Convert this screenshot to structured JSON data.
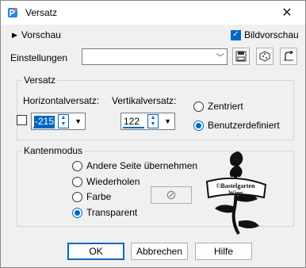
{
  "window": {
    "title": "Versatz",
    "close_glyph": "✕"
  },
  "toolbar": {
    "preview_label": "Vorschau",
    "bildvorschau_label": "Bildvorschau",
    "bildvorschau_checked": true,
    "settings_label": "Einstellungen",
    "settings_value": ""
  },
  "offset": {
    "group_title": "Versatz",
    "horizontal_label": "Horizontalversatz:",
    "horizontal_value": "-215",
    "vertical_label": "Vertikalversatz:",
    "vertical_value": "122",
    "option_centered": "Zentriert",
    "option_custom": "Benutzerdefiniert",
    "selected": "custom"
  },
  "edge_mode": {
    "group_title": "Kantenmodus",
    "options": [
      "Andere Seite übernehmen",
      "Wiederholen",
      "Farbe",
      "Transparent"
    ],
    "selected": "Transparent"
  },
  "buttons": {
    "ok": "OK",
    "cancel": "Abbrechen",
    "help": "Hilfe"
  },
  "watermark": {
    "line1": "©Bastelgarten",
    "line2": "Wien"
  },
  "colors": {
    "accent": "#0067c0",
    "background": "#f0f0f0"
  }
}
